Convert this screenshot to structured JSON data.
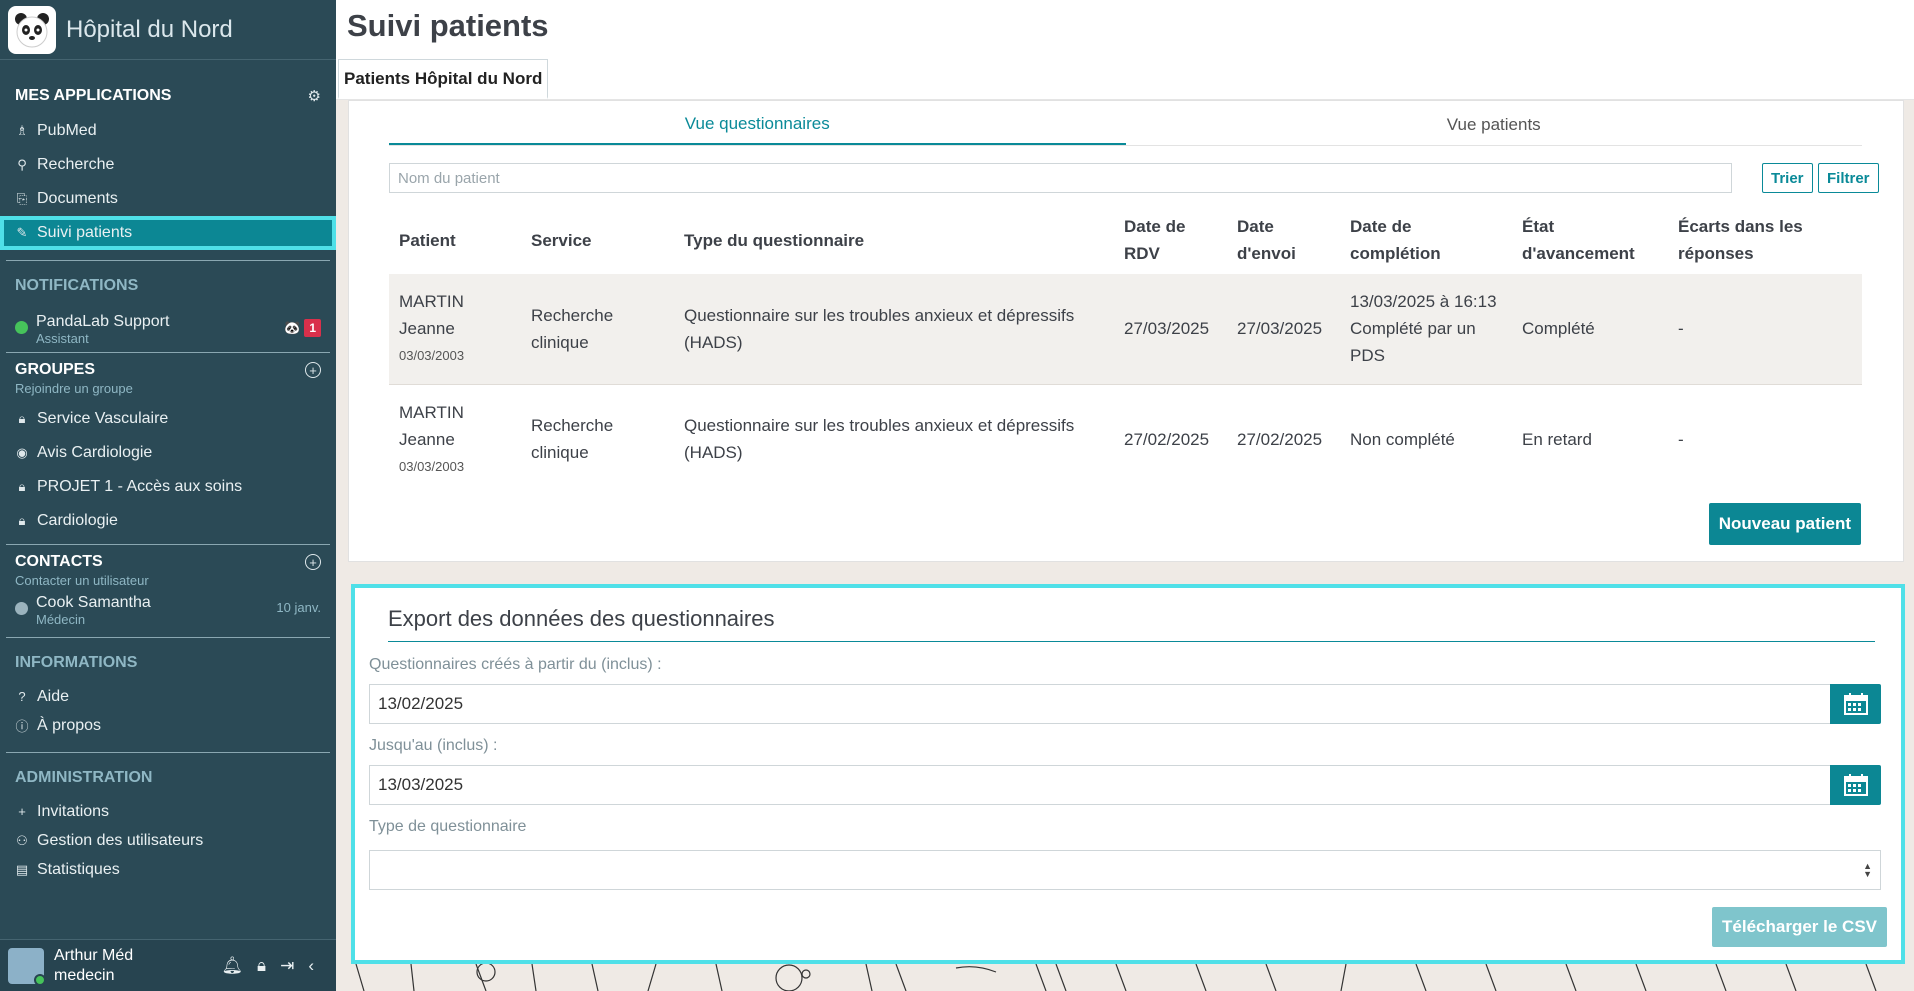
{
  "brand": {
    "title": "Hôpital du Nord"
  },
  "sidebar": {
    "apps": {
      "heading": "MES APPLICATIONS",
      "items": [
        {
          "label": "PubMed",
          "icon": "pubmed-icon"
        },
        {
          "label": "Recherche",
          "icon": "search-icon"
        },
        {
          "label": "Documents",
          "icon": "paperclip-icon"
        },
        {
          "label": "Suivi patients",
          "icon": "clipboard-icon",
          "active": true
        }
      ]
    },
    "notifications": {
      "heading": "NOTIFICATIONS",
      "items": [
        {
          "name": "PandaLab Support",
          "role": "Assistant",
          "badge": "1",
          "status_color": "#46c35b"
        }
      ]
    },
    "groups": {
      "heading": "GROUPES",
      "sub": "Rejoindre un groupe",
      "items": [
        {
          "label": "Service Vasculaire",
          "icon": "lock-icon"
        },
        {
          "label": "Avis Cardiologie",
          "icon": "eye-cloud-icon"
        },
        {
          "label": "PROJET 1 - Accès aux soins",
          "icon": "lock-icon"
        },
        {
          "label": "Cardiologie",
          "icon": "lock-icon"
        }
      ]
    },
    "contacts": {
      "heading": "CONTACTS",
      "sub": "Contacter un utilisateur",
      "items": [
        {
          "name": "Cook Samantha",
          "role": "Médecin",
          "date": "10 janv.",
          "status_color": "#9bb3bd"
        }
      ]
    },
    "informations": {
      "heading": "INFORMATIONS",
      "items": [
        {
          "label": "Aide",
          "icon": "question-icon"
        },
        {
          "label": "À propos",
          "icon": "info-icon"
        }
      ]
    },
    "administration": {
      "heading": "ADMINISTRATION",
      "items": [
        {
          "label": "Invitations",
          "icon": "plus-icon"
        },
        {
          "label": "Gestion des utilisateurs",
          "icon": "users-icon"
        },
        {
          "label": "Statistiques",
          "icon": "chart-icon"
        }
      ]
    },
    "user": {
      "name": "Arthur Méd",
      "role": "medecin"
    }
  },
  "main": {
    "title": "Suivi patients",
    "tab": "Patients Hôpital du Nord",
    "subtabs": [
      "Vue questionnaires",
      "Vue patients"
    ],
    "search_placeholder": "Nom du patient",
    "sort_label": "Trier",
    "filter_label": "Filtrer",
    "columns": [
      "Patient",
      "Service",
      "Type du questionnaire",
      "Date de RDV",
      "Date d'envoi",
      "Date de complétion",
      "État d'avancement",
      "Écarts dans les réponses"
    ],
    "rows": [
      {
        "patient": "MARTIN Jeanne",
        "dob": "03/03/2003",
        "service": "Recherche clinique",
        "type": "Questionnaire sur les troubles anxieux et dépressifs (HADS)",
        "rdv": "27/03/2025",
        "envoi": "27/03/2025",
        "completion": "13/03/2025 à 16:13 Complété par un PDS",
        "etat": "Complété",
        "ecarts": "-"
      },
      {
        "patient": "MARTIN Jeanne",
        "dob": "03/03/2003",
        "service": "Recherche clinique",
        "type": "Questionnaire sur les troubles anxieux et dépressifs (HADS)",
        "rdv": "27/02/2025",
        "envoi": "27/02/2025",
        "completion": "Non complété",
        "etat": "En retard",
        "ecarts": "-"
      }
    ],
    "new_patient_label": "Nouveau patient"
  },
  "export": {
    "title": "Export des données des questionnaires",
    "from_label": "Questionnaires créés à partir du (inclus) :",
    "from_value": "13/02/2025",
    "to_label": "Jusqu'au (inclus) :",
    "to_value": "13/03/2025",
    "type_label": "Type de questionnaire",
    "type_value": "",
    "download_label": "Télécharger le CSV"
  },
  "colors": {
    "sidebar": "#2b4a56",
    "accent": "#0c8794",
    "highlight": "#4fe0e8",
    "complete": "#87c545",
    "late": "#f0a030"
  }
}
